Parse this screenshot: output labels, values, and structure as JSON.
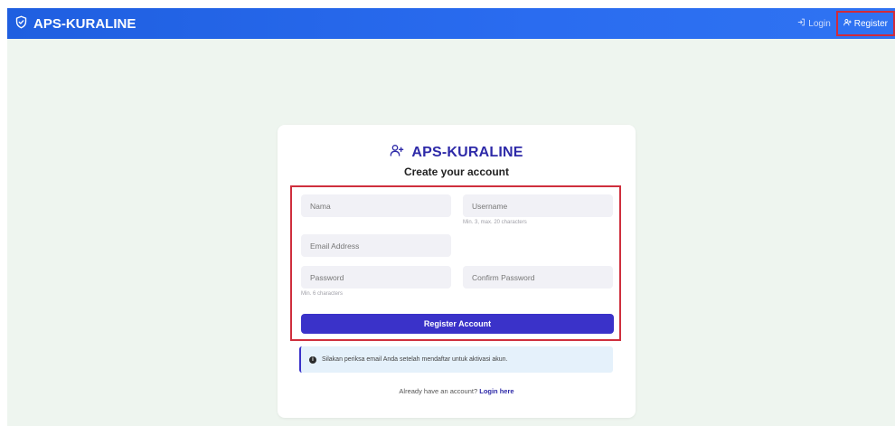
{
  "header": {
    "brand": "APS-KURALINE",
    "login_label": "Login",
    "register_label": "Register"
  },
  "card": {
    "title": "APS-KURALINE",
    "subtitle": "Create your account"
  },
  "form": {
    "nama_placeholder": "Nama",
    "username_placeholder": "Username",
    "username_hint": "Min. 3, max. 20 characters",
    "email_placeholder": "Email Address",
    "password_placeholder": "Password",
    "password_hint": "Min. 6 characters",
    "confirm_placeholder": "Confirm Password",
    "submit_label": "Register Account"
  },
  "info": {
    "message": "Silakan periksa email Anda setelah mendaftar untuk aktivasi akun."
  },
  "footer": {
    "prompt": "Already have an account?",
    "login_link": "Login here"
  },
  "colors": {
    "header_blue": "#2a6cf0",
    "accent_indigo": "#3a32c9",
    "highlight_red": "#cf2f3d"
  }
}
